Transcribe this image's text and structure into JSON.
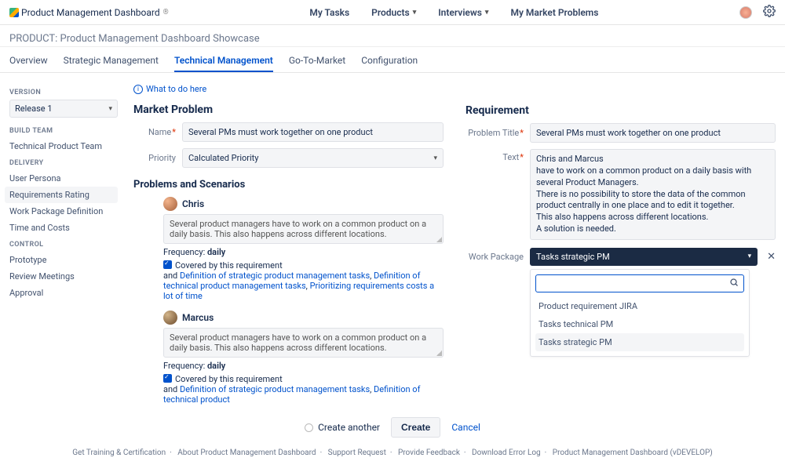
{
  "brand": {
    "name": "Product Management Dashboard",
    "reg": "®"
  },
  "topnav": {
    "my_tasks": "My Tasks",
    "products": "Products",
    "interviews": "Interviews",
    "my_market_problems": "My Market Problems"
  },
  "subhead": "PRODUCT: Product Management Dashboard Showcase",
  "tabs": {
    "overview": "Overview",
    "strategic": "Strategic Management",
    "technical": "Technical Management",
    "gtm": "Go-To-Market",
    "configuration": "Configuration"
  },
  "sidebar": {
    "version_label": "VERSION",
    "version_value": "Release 1",
    "build_team_label": "BUILD TEAM",
    "build_team_link": "Technical Product Team",
    "delivery_label": "DELIVERY",
    "delivery": {
      "user_persona": "User Persona",
      "requirements_rating": "Requirements Rating",
      "work_package_definition": "Work Package Definition",
      "time_and_costs": "Time and Costs"
    },
    "control_label": "CONTROL",
    "control": {
      "prototype": "Prototype",
      "review_meetings": "Review Meetings",
      "approval": "Approval"
    }
  },
  "whatto": "What to do here",
  "market_problem": {
    "title": "Market Problem",
    "name_label": "Name",
    "name_value": "Several PMs must work together on one product",
    "priority_label": "Priority",
    "priority_value": "Calculated Priority"
  },
  "problems_scenarios": {
    "title": "Problems and Scenarios",
    "items": [
      {
        "name": "Chris",
        "scenario": "Several product managers have to work on a common product on a daily basis. This also happens across different locations.",
        "freq_label": "Frequency:",
        "freq_value": "daily",
        "covered": "Covered by this requirement",
        "and": "and",
        "links": [
          "Definition of strategic product management tasks",
          "Definition of technical product management tasks",
          "Prioritizing requirements costs a lot of time"
        ]
      },
      {
        "name": "Marcus",
        "scenario": "Several product managers have to work on a common product on a daily basis. This also happens across different locations.",
        "freq_label": "Frequency:",
        "freq_value": "daily",
        "covered": "Covered by this requirement",
        "and": "and",
        "links": [
          "Definition of strategic product management tasks",
          "Definition of technical product"
        ]
      }
    ]
  },
  "requirement": {
    "title": "Requirement",
    "problem_title_label": "Problem Title",
    "problem_title_value": "Several PMs must work together on one product",
    "text_label": "Text",
    "text_value": "Chris and Marcus\nhave to work on a common product on a daily basis with several Product Managers.\nThere is no possibility to store the data of the common product centrally in one place and to edit it together.\nThis also happens across different locations.\nA solution is needed.",
    "work_package_label": "Work Package",
    "work_package_value": "Tasks strategic PM",
    "options": [
      "Product requirement JIRA",
      "Tasks technical PM",
      "Tasks strategic PM"
    ]
  },
  "actions": {
    "create_another": "Create another",
    "create": "Create",
    "cancel": "Cancel"
  },
  "footer": {
    "training": "Get Training & Certification",
    "about": "About Product Management Dashboard",
    "support": "Support Request",
    "feedback": "Provide Feedback",
    "error_log": "Download Error Log",
    "version": "Product Management Dashboard (vDEVELOP)"
  }
}
